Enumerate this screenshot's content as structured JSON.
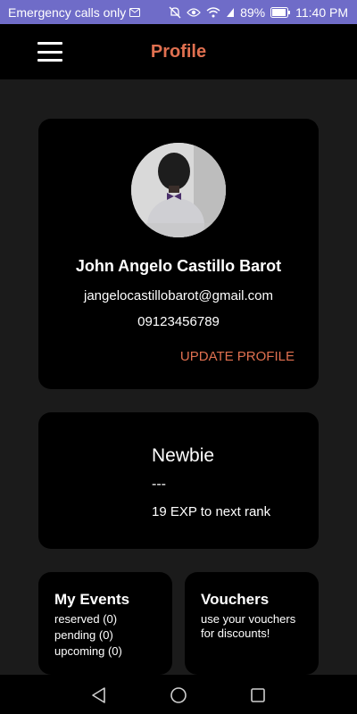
{
  "status_bar": {
    "carrier_text": "Emergency calls only",
    "battery": "89%",
    "time": "11:40 PM",
    "icons": [
      "message-icon",
      "mute-icon",
      "eye-icon",
      "wifi-icon",
      "signal-icon",
      "battery-icon"
    ]
  },
  "app_bar": {
    "title": "Profile",
    "menu_icon": "hamburger-menu-icon",
    "accent_color": "#e07050"
  },
  "profile": {
    "name": "John Angelo Castillo Barot",
    "email": "jangelocastillobarot@gmail.com",
    "phone": "09123456789",
    "update_label": "UPDATE PROFILE"
  },
  "rank": {
    "name": "Newbie",
    "dash": "---",
    "exp_text": "19 EXP to next rank"
  },
  "my_events": {
    "title": "My Events",
    "lines": [
      "reserved (0)",
      "pending (0)",
      "upcoming (0)"
    ]
  },
  "vouchers": {
    "title": "Vouchers",
    "lines": [
      "use your vouchers",
      "for discounts!"
    ]
  },
  "nav_bar": {
    "icons": [
      "back-icon",
      "home-icon",
      "recents-icon"
    ]
  }
}
